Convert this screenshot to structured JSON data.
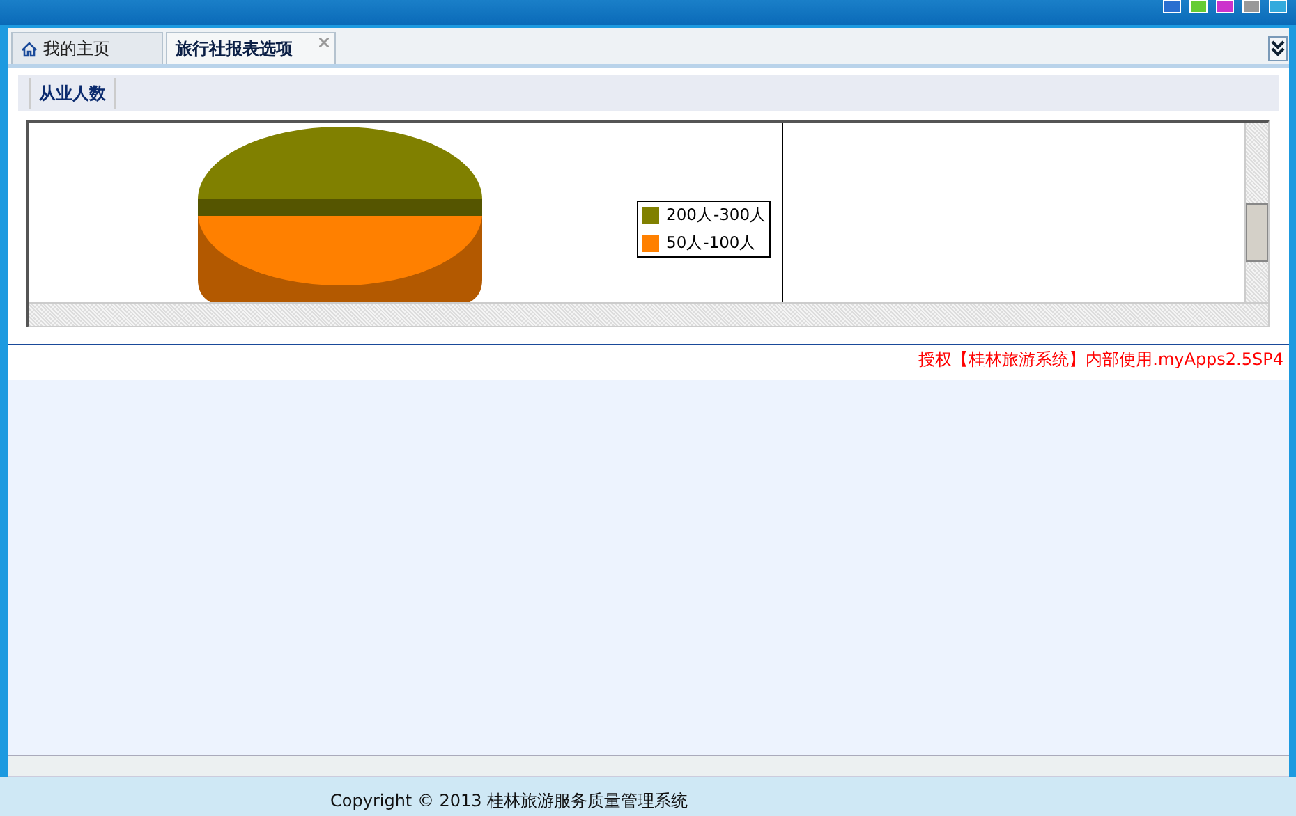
{
  "tabs": [
    {
      "label": "我的主页",
      "selected": false,
      "kind": "home"
    },
    {
      "label": "旅行社报表选项",
      "selected": true,
      "kind": "closable"
    }
  ],
  "subtabs": [
    {
      "label": "从业人数",
      "selected": true
    }
  ],
  "chart": {
    "legend": [
      {
        "label": "200人-300人",
        "color": "#808000"
      },
      {
        "label": "50人-100人",
        "color": "#ff8000"
      }
    ]
  },
  "license": "授权【桂林旅游系统】内部使用.myApps2.5SP4",
  "footer": "Copyright © 2013 桂林旅游服务质量管理系统"
}
